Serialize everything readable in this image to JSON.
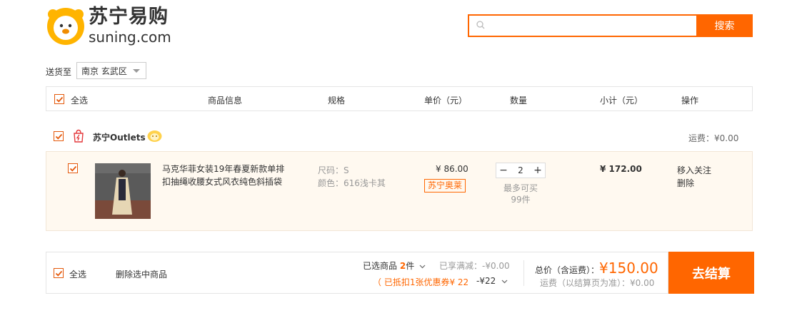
{
  "brand": {
    "cn": "苏宁易购",
    "en": "suning.com"
  },
  "search": {
    "placeholder": "",
    "button_label": "搜索"
  },
  "delivery": {
    "label": "送货至",
    "region": "南京 玄武区"
  },
  "table_header": {
    "select_all": "全选",
    "product_info": "商品信息",
    "spec": "规格",
    "unit_price": "单价（元）",
    "quantity": "数量",
    "subtotal": "小计（元）",
    "actions": "操作"
  },
  "shop": {
    "name": "苏宁Outlets",
    "shipping": "运费：¥0.00"
  },
  "item": {
    "title": "马克华菲女装19年春夏新款单排扣抽绳收腰女式风衣纯色斜插袋",
    "size": "尺码：S",
    "color": "颜色：616浅卡其",
    "price": "¥ 86.00",
    "promo": "苏宁奥莱",
    "qty_minus": "−",
    "qty": "2",
    "qty_plus": "+",
    "limit_line1": "最多可买",
    "limit_line2": "99件",
    "subtotal": "¥ 172.00",
    "action_follow": "移入关注",
    "action_delete": "删除"
  },
  "footer": {
    "select_all": "全选",
    "delete_selected": "删除选中商品",
    "selected_prefix": "已选商品",
    "selected_count": "2",
    "selected_suffix": "件",
    "discount_full": "已享满减：-¥0.00",
    "coupon": "（ 已抵扣1张优惠券¥ 22",
    "coupon_amount": "-¥22",
    "total_label": "总价（含运费）：",
    "total_value": "¥150.00",
    "shipping_note": "运费（以结算页为准）：¥0.00",
    "checkout": "去结算"
  },
  "colors": {
    "accent": "#ff6600",
    "check": "#e4590b"
  }
}
